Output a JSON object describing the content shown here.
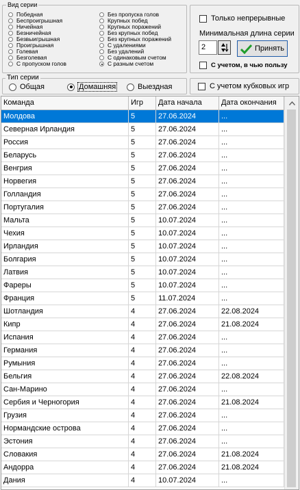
{
  "series_type_group": {
    "title": "Вид серии",
    "col1": [
      "Победная",
      "Беспроигрышная",
      "Ничейная",
      "Безничейная",
      "Безвыигрышная",
      "Проигрышная",
      "Голевая",
      "Безголевая",
      "С пропуском голов"
    ],
    "col2": [
      "Без пропуска голов",
      "Крупных побед",
      "Крупных поражений",
      "Без крупных побед",
      "Без крупных поражений",
      "С удалениями",
      "Без удалений",
      "С одинаковым счетом",
      "С разным счетом"
    ],
    "selected": "С разным счетом"
  },
  "options": {
    "continuous_only": "Только непрерывные",
    "min_length_label": "Минимальная длина серии",
    "min_length_value": "2",
    "apply_label": "Принять",
    "in_favor_label": "С учетом, в чью пользу",
    "cup_games_label": "С учетом кубковых игр"
  },
  "series_kind_group": {
    "title": "Тип серии",
    "options": [
      "Общая",
      "Домашняя",
      "Выездная"
    ],
    "selected": "Домашняя"
  },
  "table": {
    "columns": [
      "Команда",
      "Игр",
      "Дата начала",
      "Дата окончания"
    ],
    "rows": [
      [
        "Молдова",
        "5",
        "27.06.2024",
        "..."
      ],
      [
        "Северная Ирландия",
        "5",
        "27.06.2024",
        "..."
      ],
      [
        "Россия",
        "5",
        "27.06.2024",
        "..."
      ],
      [
        "Беларусь",
        "5",
        "27.06.2024",
        "..."
      ],
      [
        "Венгрия",
        "5",
        "27.06.2024",
        "..."
      ],
      [
        "Норвегия",
        "5",
        "27.06.2024",
        "..."
      ],
      [
        "Голландия",
        "5",
        "27.06.2024",
        "..."
      ],
      [
        "Португалия",
        "5",
        "27.06.2024",
        "..."
      ],
      [
        "Мальта",
        "5",
        "10.07.2024",
        "..."
      ],
      [
        "Чехия",
        "5",
        "10.07.2024",
        "..."
      ],
      [
        "Ирландия",
        "5",
        "10.07.2024",
        "..."
      ],
      [
        "Болгария",
        "5",
        "10.07.2024",
        "..."
      ],
      [
        "Латвия",
        "5",
        "10.07.2024",
        "..."
      ],
      [
        "Фареры",
        "5",
        "10.07.2024",
        "..."
      ],
      [
        "Франция",
        "5",
        "11.07.2024",
        "..."
      ],
      [
        "Шотландия",
        "4",
        "27.06.2024",
        "22.08.2024"
      ],
      [
        "Кипр",
        "4",
        "27.06.2024",
        "21.08.2024"
      ],
      [
        "Испания",
        "4",
        "27.06.2024",
        "..."
      ],
      [
        "Германия",
        "4",
        "27.06.2024",
        "..."
      ],
      [
        "Румыния",
        "4",
        "27.06.2024",
        "..."
      ],
      [
        "Бельгия",
        "4",
        "27.06.2024",
        "22.08.2024"
      ],
      [
        "Сан-Марино",
        "4",
        "27.06.2024",
        "..."
      ],
      [
        "Сербия и Черногория",
        "4",
        "27.06.2024",
        "21.08.2024"
      ],
      [
        "Грузия",
        "4",
        "27.06.2024",
        "..."
      ],
      [
        "Нормандские острова",
        "4",
        "27.06.2024",
        "..."
      ],
      [
        "Эстония",
        "4",
        "27.06.2024",
        "..."
      ],
      [
        "Словакия",
        "4",
        "27.06.2024",
        "21.08.2024"
      ],
      [
        "Андорра",
        "4",
        "27.06.2024",
        "21.08.2024"
      ],
      [
        "Дания",
        "4",
        "10.07.2024",
        "..."
      ]
    ],
    "selected_row": 0
  },
  "icons": {
    "apply": "checkmark-icon",
    "spin": "spin-updown-icon",
    "scroll_up": "scroll-up-arrow-icon"
  },
  "colors": {
    "selection": "#0078d7",
    "apply_check": "#1f9d2a"
  }
}
